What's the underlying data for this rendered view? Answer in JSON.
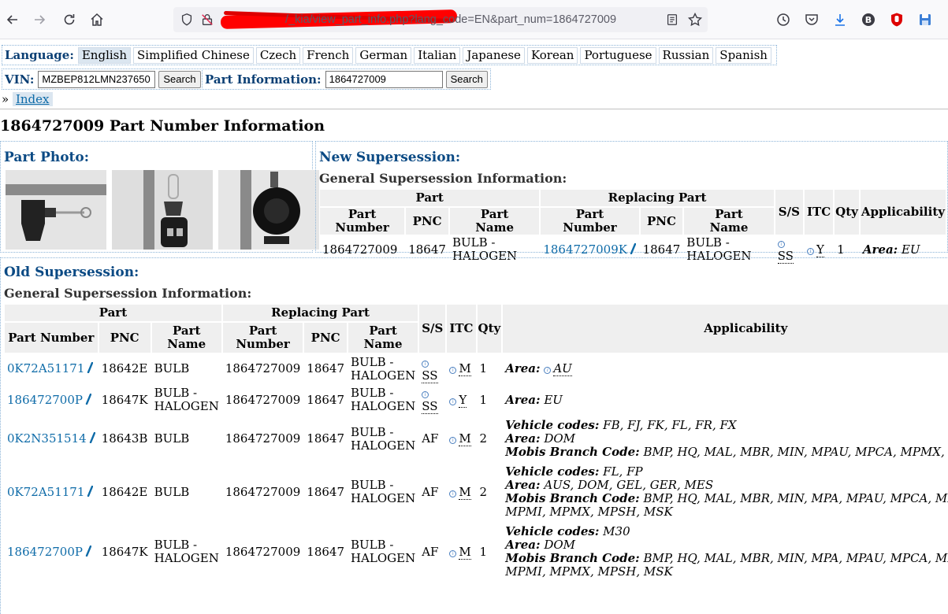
{
  "browser": {
    "url_prefix": "/_kia/view_part_info.php?lang_code=EN&part_num=1864727009"
  },
  "language_bar": {
    "label": "Language:",
    "languages": [
      "English",
      "Simplified Chinese",
      "Czech",
      "French",
      "German",
      "Italian",
      "Japanese",
      "Korean",
      "Portuguese",
      "Russian",
      "Spanish"
    ],
    "active": "English"
  },
  "vin_search": {
    "label": "VIN:",
    "value": "MZBEP812LMN237650",
    "button": "Search"
  },
  "part_search": {
    "label": "Part Information:",
    "value": "1864727009",
    "button": "Search"
  },
  "breadcrumb": {
    "prefix": "»",
    "index_label": "Index"
  },
  "page_title": "1864727009 Part Number Information",
  "photo_panel": {
    "title": "Part Photo:"
  },
  "new_supersession": {
    "title": "New Supersession:",
    "subtitle": "General Supersession Information:",
    "headers": {
      "part": "Part",
      "replacing_part": "Replacing Part",
      "ss": "S/S",
      "itc": "ITC",
      "qty": "Qty",
      "applicability": "Applicability",
      "part_number": "Part Number",
      "pnc": "PNC",
      "part_name": "Part Name"
    },
    "rows": [
      {
        "part_number": "1864727009",
        "pnc": "18647",
        "part_name": "BULB - HALOGEN",
        "rep_number": "1864727009K",
        "rep_pnc": "18647",
        "rep_name": "BULB - HALOGEN",
        "ss": "SS",
        "itc": "Y",
        "qty": "1",
        "area_label": "Area:",
        "area": "EU"
      }
    ]
  },
  "old_supersession": {
    "title": "Old Supersession:",
    "subtitle": "General Supersession Information:",
    "headers": {
      "part": "Part",
      "replacing_part": "Replacing Part",
      "ss": "S/S",
      "itc": "ITC",
      "qty": "Qty",
      "applicability": "Applicability",
      "part_number": "Part Number",
      "pnc": "PNC",
      "part_name": "Part Name"
    },
    "labels": {
      "vehicle_codes": "Vehicle codes:",
      "area": "Area:",
      "mobis": "Mobis Branch Code:"
    },
    "rows": [
      {
        "part_number": "0K72A51171",
        "pnc": "18642E",
        "part_name": "BULB",
        "rep_number": "1864727009",
        "rep_pnc": "18647",
        "rep_name": "BULB - HALOGEN",
        "ss": "SS",
        "itc": "M",
        "qty": "1",
        "vehicle_codes": "",
        "area": "AU",
        "mobis": ""
      },
      {
        "part_number": "186472700P",
        "pnc": "18647K",
        "part_name": "BULB - HALOGEN",
        "rep_number": "1864727009",
        "rep_pnc": "18647",
        "rep_name": "BULB - HALOGEN",
        "ss": "SS",
        "itc": "Y",
        "qty": "1",
        "vehicle_codes": "",
        "area": "EU",
        "mobis": ""
      },
      {
        "part_number": "0K2N351514",
        "pnc": "18643B",
        "part_name": "BULB",
        "rep_number": "1864727009",
        "rep_pnc": "18647",
        "rep_name": "BULB - HALOGEN",
        "ss": "AF",
        "itc": "M",
        "qty": "2",
        "vehicle_codes": "FB, FJ, FK, FL, FR, FX",
        "area": "DOM",
        "mobis": "BMP, HQ, MAL, MBR, MIN, MPAU, MPCA, MPMX, MSK"
      },
      {
        "part_number": "0K72A51171",
        "pnc": "18642E",
        "part_name": "BULB",
        "rep_number": "1864727009",
        "rep_pnc": "18647",
        "rep_name": "BULB - HALOGEN",
        "ss": "AF",
        "itc": "M",
        "qty": "2",
        "vehicle_codes": "FL, FP",
        "area": "AUS, DOM, GEL, GER, MES",
        "mobis": "BMP, HQ, MAL, MBR, MIN, MPA, MPAU, MPCA, MPJY, M",
        "mobis_line2": "MPMI, MPMX, MPSH, MSK"
      },
      {
        "part_number": "186472700P",
        "pnc": "18647K",
        "part_name": "BULB - HALOGEN",
        "rep_number": "1864727009",
        "rep_pnc": "18647",
        "rep_name": "BULB - HALOGEN",
        "ss": "AF",
        "itc": "M",
        "qty": "1",
        "vehicle_codes": "M30",
        "area": "DOM",
        "mobis": "BMP, HQ, MAL, MBR, MIN, MPA, MPAU, MPCA, MPJY, M",
        "mobis_line2": "MPMI, MPMX, MPSH, MSK"
      }
    ]
  },
  "colors": {
    "link": "#0e6ba8",
    "heading": "#0b4a84",
    "redaction": "#ff0000"
  }
}
